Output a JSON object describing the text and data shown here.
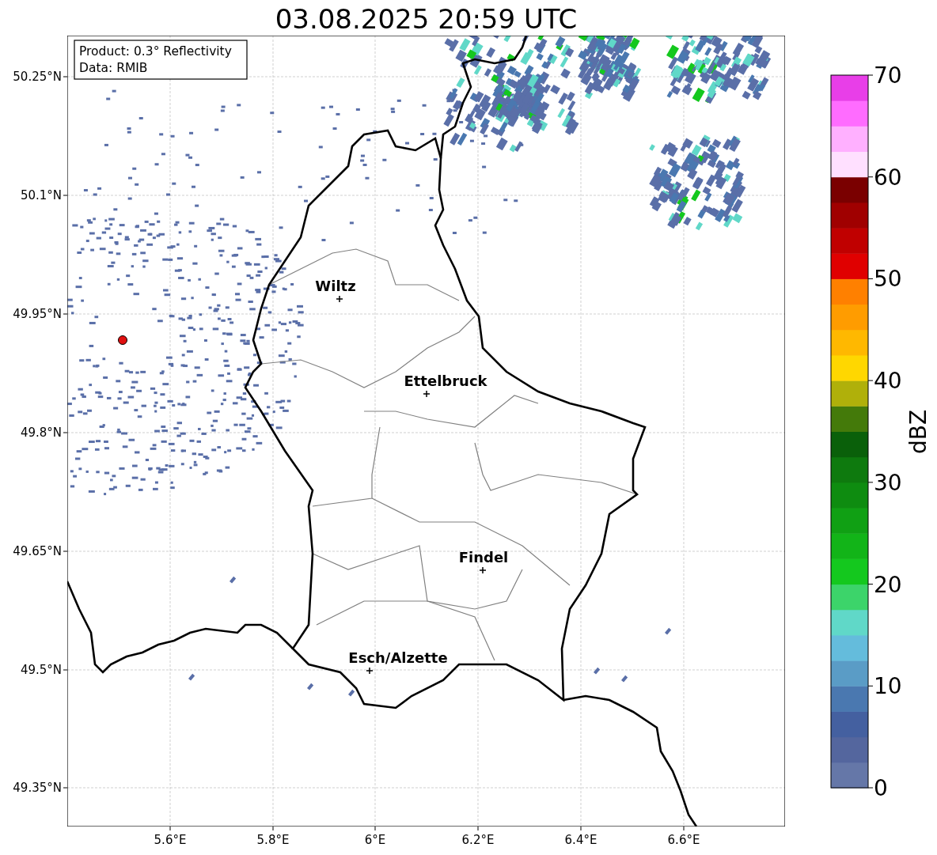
{
  "title": "03.08.2025 20:59 UTC",
  "info_box": {
    "lines": [
      "Product: 0.3° Reflectivity",
      "Data: RMIB"
    ]
  },
  "map": {
    "y_ticks": [
      "50.25°N",
      "50.1°N",
      "49.95°N",
      "49.8°N",
      "49.65°N",
      "49.5°N",
      "49.35°N"
    ],
    "x_ticks": [
      "5.6°E",
      "5.8°E",
      "6°E",
      "6.2°E",
      "6.4°E",
      "6.6°E"
    ],
    "places": [
      {
        "name": "Wiltz"
      },
      {
        "name": "Ettelbruck"
      },
      {
        "name": "Findel"
      },
      {
        "name": "Esch/Alzette"
      }
    ]
  },
  "colorbar": {
    "label": "dBZ",
    "ticks": [
      "70",
      "60",
      "50",
      "40",
      "30",
      "20",
      "10",
      "0"
    ],
    "bands": [
      {
        "color": "#6577a8"
      },
      {
        "color": "#54669e"
      },
      {
        "color": "#4460a0"
      },
      {
        "color": "#4a78b0"
      },
      {
        "color": "#5a9cc6"
      },
      {
        "color": "#64bcdc"
      },
      {
        "color": "#60d8c8"
      },
      {
        "color": "#3cd46a"
      },
      {
        "color": "#14c81e"
      },
      {
        "color": "#12b418"
      },
      {
        "color": "#10a014"
      },
      {
        "color": "#0e8c10"
      },
      {
        "color": "#0e7a0e"
      },
      {
        "color": "#0a600a"
      },
      {
        "color": "#447a0a"
      },
      {
        "color": "#b0b00a"
      },
      {
        "color": "#ffd700"
      },
      {
        "color": "#ffb800"
      },
      {
        "color": "#ff9c00"
      },
      {
        "color": "#ff8000"
      },
      {
        "color": "#e00000"
      },
      {
        "color": "#c00000"
      },
      {
        "color": "#a00000"
      },
      {
        "color": "#7a0000"
      },
      {
        "color": "#ffe0ff"
      },
      {
        "color": "#ffb0ff"
      },
      {
        "color": "#ff6cff"
      },
      {
        "color": "#e83ee8"
      }
    ]
  }
}
